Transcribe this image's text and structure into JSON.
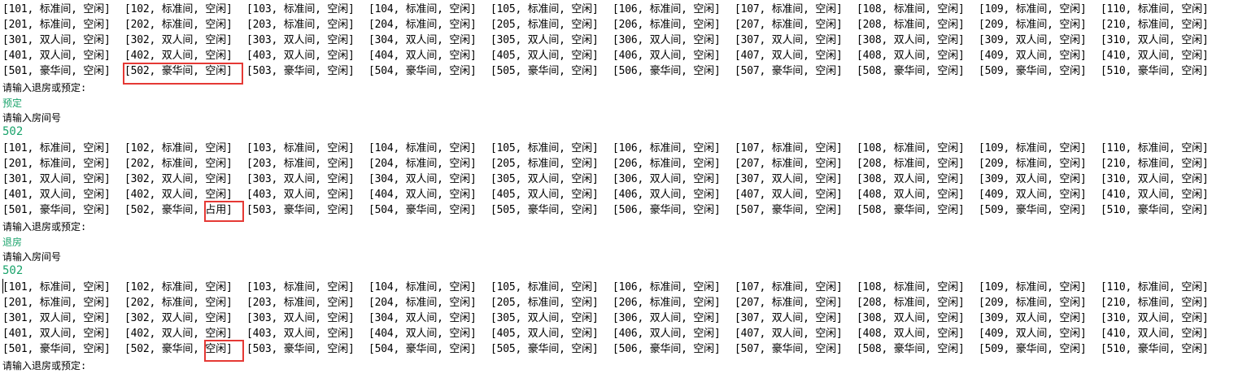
{
  "console": {
    "blocks": [
      {
        "rows": [
          [
            "[101, 标准间, 空闲]",
            "[102, 标准间, 空闲]",
            "[103, 标准间, 空闲]",
            "[104, 标准间, 空闲]",
            "[105, 标准间, 空闲]",
            "[106, 标准间, 空闲]",
            "[107, 标准间, 空闲]",
            "[108, 标准间, 空闲]",
            "[109, 标准间, 空闲]",
            "[110, 标准间, 空闲]"
          ],
          [
            "[201, 标准间, 空闲]",
            "[202, 标准间, 空闲]",
            "[203, 标准间, 空闲]",
            "[204, 标准间, 空闲]",
            "[205, 标准间, 空闲]",
            "[206, 标准间, 空闲]",
            "[207, 标准间, 空闲]",
            "[208, 标准间, 空闲]",
            "[209, 标准间, 空闲]",
            "[210, 标准间, 空闲]"
          ],
          [
            "[301, 双人间, 空闲]",
            "[302, 双人间, 空闲]",
            "[303, 双人间, 空闲]",
            "[304, 双人间, 空闲]",
            "[305, 双人间, 空闲]",
            "[306, 双人间, 空闲]",
            "[307, 双人间, 空闲]",
            "[308, 双人间, 空闲]",
            "[309, 双人间, 空闲]",
            "[310, 双人间, 空闲]"
          ],
          [
            "[401, 双人间, 空闲]",
            "[402, 双人间, 空闲]",
            "[403, 双人间, 空闲]",
            "[404, 双人间, 空闲]",
            "[405, 双人间, 空闲]",
            "[406, 双人间, 空闲]",
            "[407, 双人间, 空闲]",
            "[408, 双人间, 空闲]",
            "[409, 双人间, 空闲]",
            "[410, 双人间, 空闲]"
          ],
          [
            "[501, 豪华间, 空闲]",
            "[502, 豪华间, 空闲]",
            "[503, 豪华间, 空闲]",
            "[504, 豪华间, 空闲]",
            "[505, 豪华间, 空闲]",
            "[506, 豪华间, 空闲]",
            "[507, 豪华间, 空闲]",
            "[508, 豪华间, 空闲]",
            "[509, 豪华间, 空闲]",
            "[510, 豪华间, 空闲]"
          ]
        ],
        "prompt_action": "请输入退房或预定:",
        "input_action": "预定",
        "prompt_room": "请输入房间号",
        "input_room": "502"
      },
      {
        "rows": [
          [
            "[101, 标准间, 空闲]",
            "[102, 标准间, 空闲]",
            "[103, 标准间, 空闲]",
            "[104, 标准间, 空闲]",
            "[105, 标准间, 空闲]",
            "[106, 标准间, 空闲]",
            "[107, 标准间, 空闲]",
            "[108, 标准间, 空闲]",
            "[109, 标准间, 空闲]",
            "[110, 标准间, 空闲]"
          ],
          [
            "[201, 标准间, 空闲]",
            "[202, 标准间, 空闲]",
            "[203, 标准间, 空闲]",
            "[204, 标准间, 空闲]",
            "[205, 标准间, 空闲]",
            "[206, 标准间, 空闲]",
            "[207, 标准间, 空闲]",
            "[208, 标准间, 空闲]",
            "[209, 标准间, 空闲]",
            "[210, 标准间, 空闲]"
          ],
          [
            "[301, 双人间, 空闲]",
            "[302, 双人间, 空闲]",
            "[303, 双人间, 空闲]",
            "[304, 双人间, 空闲]",
            "[305, 双人间, 空闲]",
            "[306, 双人间, 空闲]",
            "[307, 双人间, 空闲]",
            "[308, 双人间, 空闲]",
            "[309, 双人间, 空闲]",
            "[310, 双人间, 空闲]"
          ],
          [
            "[401, 双人间, 空闲]",
            "[402, 双人间, 空闲]",
            "[403, 双人间, 空闲]",
            "[404, 双人间, 空闲]",
            "[405, 双人间, 空闲]",
            "[406, 双人间, 空闲]",
            "[407, 双人间, 空闲]",
            "[408, 双人间, 空闲]",
            "[409, 双人间, 空闲]",
            "[410, 双人间, 空闲]"
          ],
          [
            "[501, 豪华间, 空闲]",
            "[502, 豪华间, 占用]",
            "[503, 豪华间, 空闲]",
            "[504, 豪华间, 空闲]",
            "[505, 豪华间, 空闲]",
            "[506, 豪华间, 空闲]",
            "[507, 豪华间, 空闲]",
            "[508, 豪华间, 空闲]",
            "[509, 豪华间, 空闲]",
            "[510, 豪华间, 空闲]"
          ]
        ],
        "prompt_action": "请输入退房或预定:",
        "input_action": "退房",
        "prompt_room": "请输入房间号",
        "input_room": "502"
      },
      {
        "rows": [
          [
            "[101, 标准间, 空闲]",
            "[102, 标准间, 空闲]",
            "[103, 标准间, 空闲]",
            "[104, 标准间, 空闲]",
            "[105, 标准间, 空闲]",
            "[106, 标准间, 空闲]",
            "[107, 标准间, 空闲]",
            "[108, 标准间, 空闲]",
            "[109, 标准间, 空闲]",
            "[110, 标准间, 空闲]"
          ],
          [
            "[201, 标准间, 空闲]",
            "[202, 标准间, 空闲]",
            "[203, 标准间, 空闲]",
            "[204, 标准间, 空闲]",
            "[205, 标准间, 空闲]",
            "[206, 标准间, 空闲]",
            "[207, 标准间, 空闲]",
            "[208, 标准间, 空闲]",
            "[209, 标准间, 空闲]",
            "[210, 标准间, 空闲]"
          ],
          [
            "[301, 双人间, 空闲]",
            "[302, 双人间, 空闲]",
            "[303, 双人间, 空闲]",
            "[304, 双人间, 空闲]",
            "[305, 双人间, 空闲]",
            "[306, 双人间, 空闲]",
            "[307, 双人间, 空闲]",
            "[308, 双人间, 空闲]",
            "[309, 双人间, 空闲]",
            "[310, 双人间, 空闲]"
          ],
          [
            "[401, 双人间, 空闲]",
            "[402, 双人间, 空闲]",
            "[403, 双人间, 空闲]",
            "[404, 双人间, 空闲]",
            "[405, 双人间, 空闲]",
            "[406, 双人间, 空闲]",
            "[407, 双人间, 空闲]",
            "[408, 双人间, 空闲]",
            "[409, 双人间, 空闲]",
            "[410, 双人间, 空闲]"
          ],
          [
            "[501, 豪华间, 空闲]",
            "[502, 豪华间, 空闲]",
            "[503, 豪华间, 空闲]",
            "[504, 豪华间, 空闲]",
            "[505, 豪华间, 空闲]",
            "[506, 豪华间, 空闲]",
            "[507, 豪华间, 空闲]",
            "[508, 豪华间, 空闲]",
            "[509, 豪华间, 空闲]",
            "[510, 豪华间, 空闲]"
          ]
        ],
        "prompt_action": "请输入退房或预定:"
      }
    ]
  },
  "colors": {
    "input_echo": "#1aa36b",
    "highlight_border": "#e53935",
    "text": "#000000",
    "background": "#ffffff"
  }
}
